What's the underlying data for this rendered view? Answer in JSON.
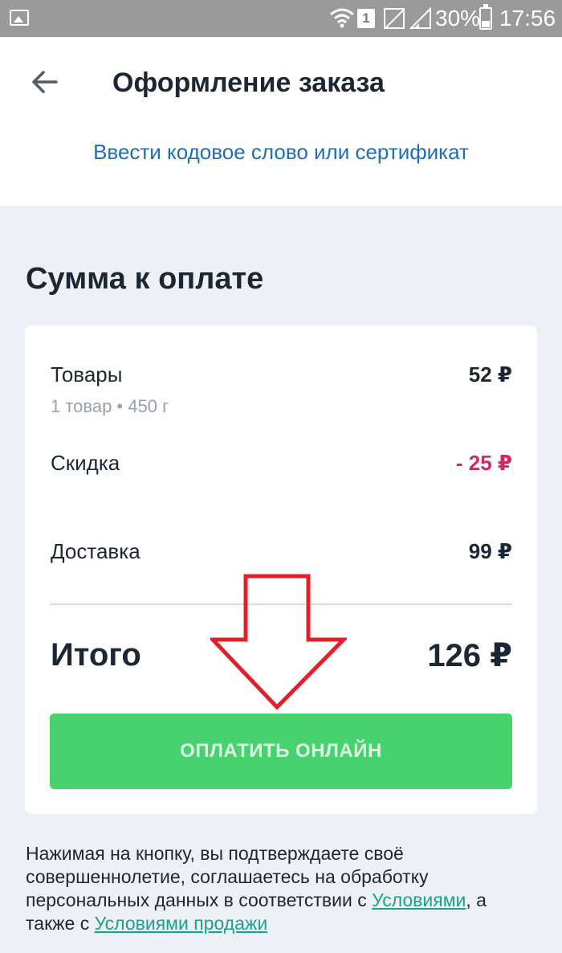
{
  "status_bar": {
    "battery_percent": "30%",
    "time": "17:56",
    "sim_slot": "1"
  },
  "header": {
    "title": "Оформление заказа",
    "promo_link": "Ввести кодовое слово или сертификат"
  },
  "summary": {
    "section_title": "Сумма к оплате",
    "goods_label": "Товары",
    "goods_value": "52 ₽",
    "goods_sub": "1 товар • 450 г",
    "discount_label": "Скидка",
    "discount_value": "- 25 ₽",
    "delivery_label": "Доставка",
    "delivery_value": "99 ₽",
    "total_label": "Итого",
    "total_value": "126 ₽",
    "pay_button": "ОПЛАТИТЬ ОНЛАЙН"
  },
  "disclaimer": {
    "text_before": "Нажимая на кнопку, вы подтверждаете своё совершеннолетие, соглашаетесь на обработку персональных данных в соответствии с ",
    "link_terms": "Условиями",
    "text_middle": ", а также с ",
    "link_sale_terms": "Условиями продажи"
  },
  "colors": {
    "accent_link": "#1f6fb8",
    "pay_button": "#43d26a",
    "discount": "#d02a61",
    "legal_link": "#1aa28a",
    "annotation_arrow": "#e0202a"
  }
}
